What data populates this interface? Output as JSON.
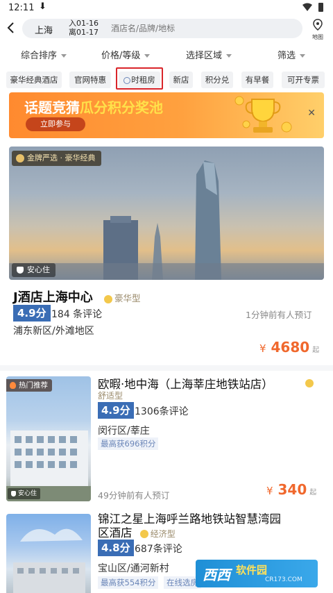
{
  "status": {
    "time": "12:11",
    "download_glyph": "⬇"
  },
  "search": {
    "city": "上海",
    "checkin": "入01-16",
    "checkout": "离01-17",
    "placeholder": "酒店名/品牌/地标",
    "map_label": "地图"
  },
  "filters": [
    "综合排序",
    "价格/等级",
    "选择区域",
    "筛选"
  ],
  "tags": [
    "豪华经典酒店",
    "官网特惠",
    "时租房",
    "新店",
    "积分兑",
    "有早餐",
    "可开专票"
  ],
  "banner": {
    "title_a": "话题竞猜",
    "title_b": "瓜分积分奖池",
    "button": "立即参与"
  },
  "hotels": [
    {
      "badge": "金牌严选 · 豪华经典",
      "safe": "安心住",
      "name": "J酒店上海中心",
      "type": "豪华型",
      "score": "4.9分",
      "reviews": "184 条评论",
      "recent": "1分钟前有人预订",
      "area": "浦东新区/外滩地区",
      "price_symbol": "¥",
      "price": "4680",
      "price_suffix": "起"
    },
    {
      "badge": "热门推荐",
      "safe": "安心住",
      "name": "欧暇·地中海（上海莘庄地铁站店）",
      "type": "舒适型",
      "score": "4.9分",
      "reviews": "1306条评论",
      "area": "闵行区/莘庄",
      "points": "最高获696积分",
      "recent": "49分钟前有人预订",
      "price_symbol": "¥",
      "price": "340",
      "price_suffix": "起"
    },
    {
      "name_line1": "锦江之星上海呼兰路地铁站智慧湾园",
      "name_line2": "区酒店",
      "type": "经济型",
      "score": "4.8分",
      "reviews": "687条评论",
      "area": "宝山区/通河新村",
      "points": "最高获554积分",
      "online": "在线选房"
    }
  ],
  "watermark": {
    "brand": "西西",
    "text": "软件园",
    "domain": "CR173.COM"
  },
  "colors": {
    "accent": "#f0682d",
    "score_bg": "#3a6db5",
    "highlight_border": "#d9252a",
    "banner_start": "#ff8a2f"
  }
}
